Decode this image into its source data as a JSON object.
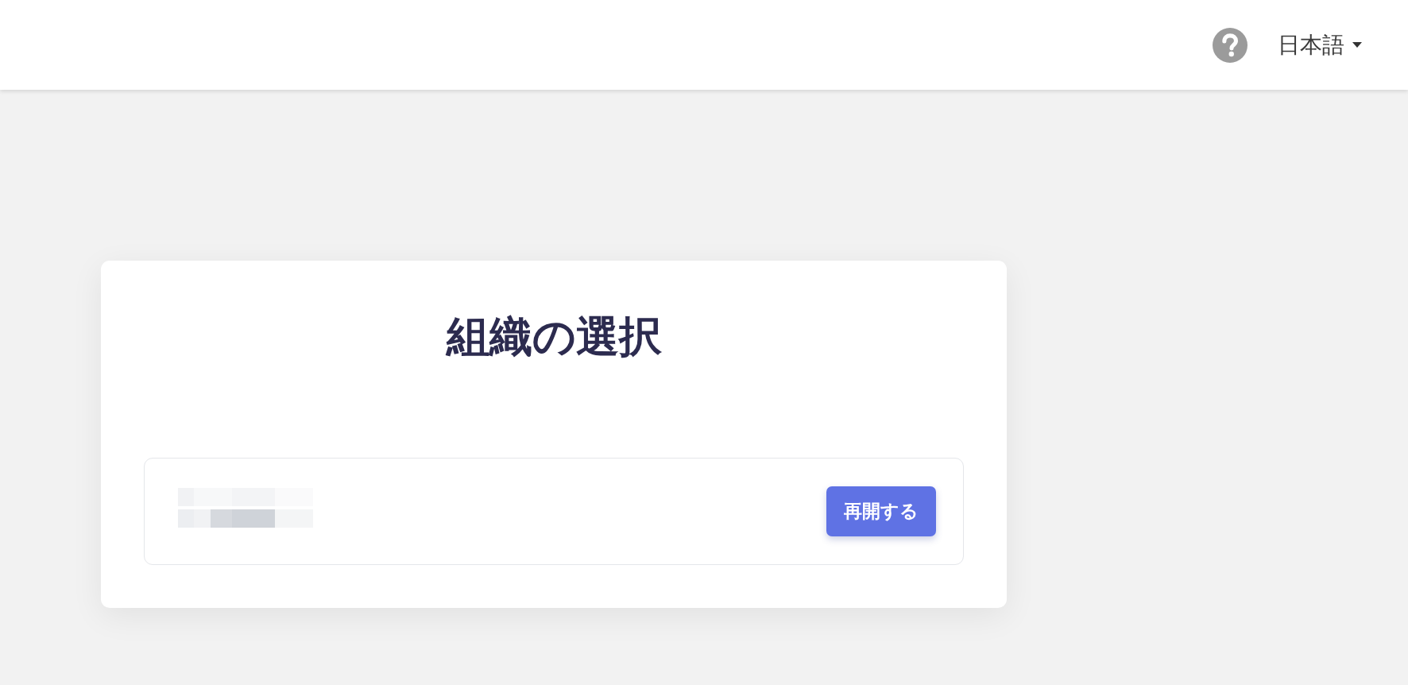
{
  "header": {
    "language_menu": {
      "label": "日本語"
    }
  },
  "main": {
    "title": "組織の選択",
    "organizations": [
      {
        "action": "再開する"
      }
    ]
  }
}
